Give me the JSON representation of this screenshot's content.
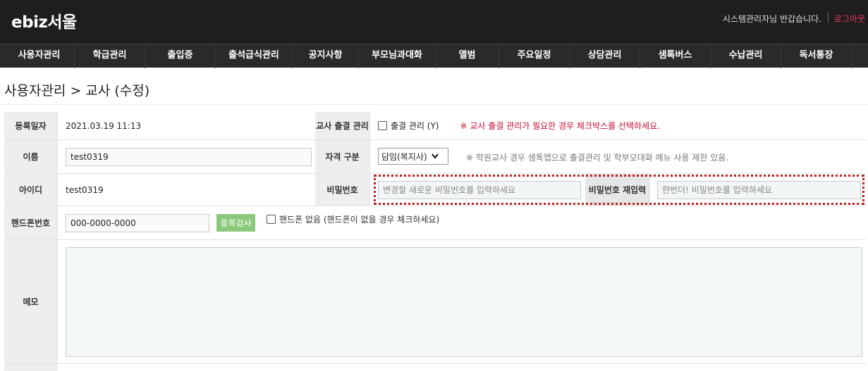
{
  "header": {
    "logo": "ebiz서울",
    "welcome": "시스템관리자님 반갑습니다.",
    "logout": "로그아웃"
  },
  "nav": [
    {
      "label": "사용자관리",
      "name": "nav-user-management"
    },
    {
      "label": "학급관리",
      "name": "nav-class-management"
    },
    {
      "label": "출입증",
      "name": "nav-access-pass"
    },
    {
      "label": "출석급식관리",
      "name": "nav-attendance-meal"
    },
    {
      "label": "공지사항",
      "name": "nav-notice"
    },
    {
      "label": "부모님과대화",
      "name": "nav-parent-chat"
    },
    {
      "label": "앨범",
      "name": "nav-album"
    },
    {
      "label": "주요일정",
      "name": "nav-schedule"
    },
    {
      "label": "상담관리",
      "name": "nav-counsel"
    },
    {
      "label": "샘톡버스",
      "name": "nav-samtalk-bus"
    },
    {
      "label": "수납관리",
      "name": "nav-payment"
    },
    {
      "label": "독서통장",
      "name": "nav-reading-log"
    }
  ],
  "page_title": "사용자관리 > 교사 (수정)",
  "form": {
    "reg_date_label": "등록일자",
    "reg_date_value": "2021.03.19 11:13",
    "teacher_attend_label": "교사 출결 관리",
    "attend_checkbox_label": "출결 관리 (Y)",
    "attend_note": "※ 교사 출결 관리가 필요한 경우 체크박스를 선택하세요.",
    "name_label": "이름",
    "name_value": "test0319",
    "qualification_label": "자격 구분",
    "qualification_value": "담임(복지사)",
    "qualification_note": "※ 학원교사 경우 샘톡앱으로 출결관리 및 학부모대화 메뉴 사용 제한 있음.",
    "id_label": "아이디",
    "id_value": "test0319",
    "password_label": "비밀번호",
    "password_placeholder": "변경할 새로운 비밀번호를 입력하세요",
    "password_confirm_label": "비밀번호 재입력",
    "password_confirm_placeholder": "한번더! 비밀번호를 입력하세요",
    "phone_label": "핸드폰번호",
    "phone_value": "000-0000-0000",
    "dup_check_button": "중복검사",
    "no_phone_label": "핸드폰 없음 (핸드폰이 없을 경우 체크하세요)",
    "memo_label": "메모",
    "memo_value": ""
  }
}
